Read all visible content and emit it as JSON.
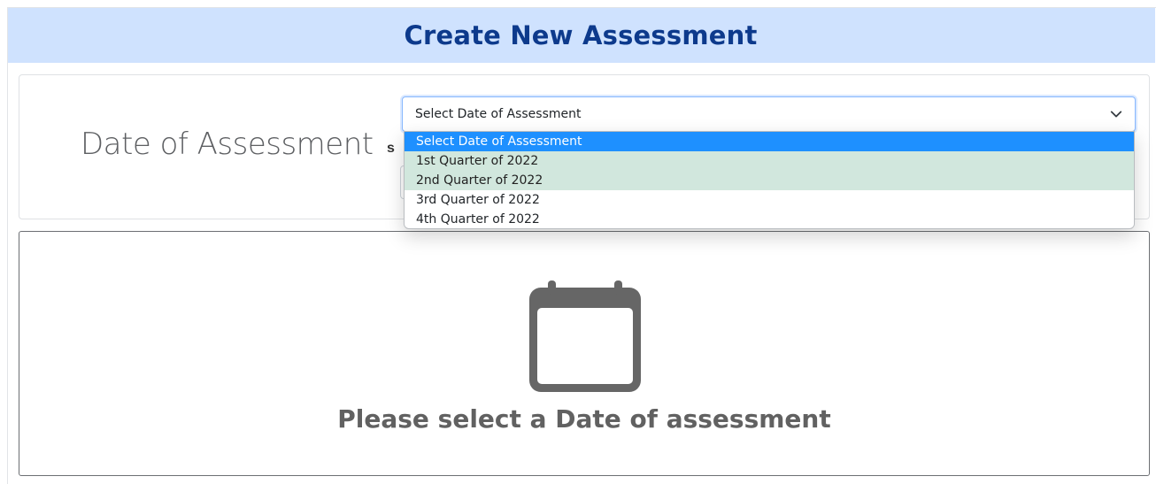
{
  "header": {
    "title": "Create New Assessment",
    "background": "#cfe2fe",
    "title_color": "#0d3a8c"
  },
  "date_section": {
    "label": "Date of Assessment",
    "select": {
      "selected_value": "Select Date of Assessment",
      "icon": "chevron-down-icon",
      "options": [
        "Select Date of Assessment",
        "1st Quarter of 2022",
        "2nd Quarter of 2022",
        "3rd Quarter of 2022",
        "4th Quarter of 2022"
      ],
      "highlight_color": "#1e90ff",
      "tint_color": "#d1e7dd"
    }
  },
  "empty_state": {
    "icon": "calendar-icon",
    "message": "Please select a Date of assessment",
    "icon_color": "#666666"
  }
}
